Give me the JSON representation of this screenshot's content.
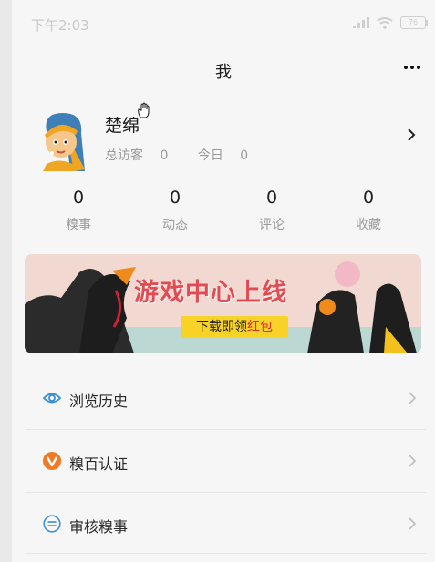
{
  "status_bar": {
    "time": "下午2:03",
    "battery": "76"
  },
  "header": {
    "title": "我"
  },
  "profile": {
    "name": "楚绵",
    "visitors_total_label": "总访客",
    "visitors_total": "0",
    "visitors_today_label": "今日",
    "visitors_today": "0"
  },
  "counts": [
    {
      "value": "0",
      "label": "糗事"
    },
    {
      "value": "0",
      "label": "动态"
    },
    {
      "value": "0",
      "label": "评论"
    },
    {
      "value": "0",
      "label": "收藏"
    }
  ],
  "banner": {
    "title": "游戏中心上线",
    "cta_prefix": "下载即领",
    "cta_highlight": "红包"
  },
  "menu": [
    {
      "label": "浏览历史",
      "icon": "eye-icon"
    },
    {
      "label": "糗百认证",
      "icon": "verified-v-icon"
    },
    {
      "label": "审核糗事",
      "icon": "review-icon"
    }
  ],
  "colors": {
    "accent_blue": "#3a8fd6",
    "accent_orange": "#f07a22",
    "banner_red": "#e34b53",
    "banner_yellow": "#f7d327"
  }
}
